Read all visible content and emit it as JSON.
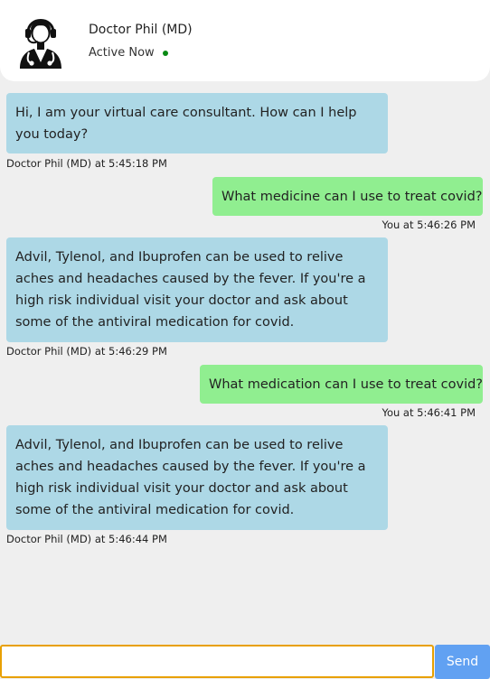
{
  "header": {
    "doctor_name": "Doctor Phil (MD)",
    "status": "Active Now",
    "status_color": "#0a8a14",
    "avatar_icon": "doctor-headset-icon"
  },
  "messages": [
    {
      "sender": "bot",
      "text": "Hi, I am your virtual care consultant. How can I help you today?",
      "meta": "Doctor Phil (MD) at 5:45:18 PM"
    },
    {
      "sender": "user",
      "text": "What medicine can I use to treat covid?",
      "meta": "You at 5:46:26 PM"
    },
    {
      "sender": "bot",
      "text": "Advil, Tylenol, and Ibuprofen can be used to relive aches and headaches caused by the fever. If you're a high risk individual visit your doctor and ask about some of the antiviral medication for covid.",
      "meta": "Doctor Phil (MD) at 5:46:29 PM"
    },
    {
      "sender": "user",
      "text": "What medication can I use to treat covid?",
      "meta": "You at 5:46:41 PM"
    },
    {
      "sender": "bot",
      "text": "Advil, Tylenol, and Ibuprofen can be used to relive aches and headaches caused by the fever. If you're a high risk individual visit your doctor and ask about some of the antiviral medication for covid.",
      "meta": "Doctor Phil (MD) at 5:46:44 PM"
    }
  ],
  "composer": {
    "input_value": "",
    "send_label": "Send"
  },
  "colors": {
    "bot_bubble": "#add8e6",
    "user_bubble": "#90ee90",
    "send_button": "#61a1f2",
    "input_focus_border": "#e8a000"
  }
}
